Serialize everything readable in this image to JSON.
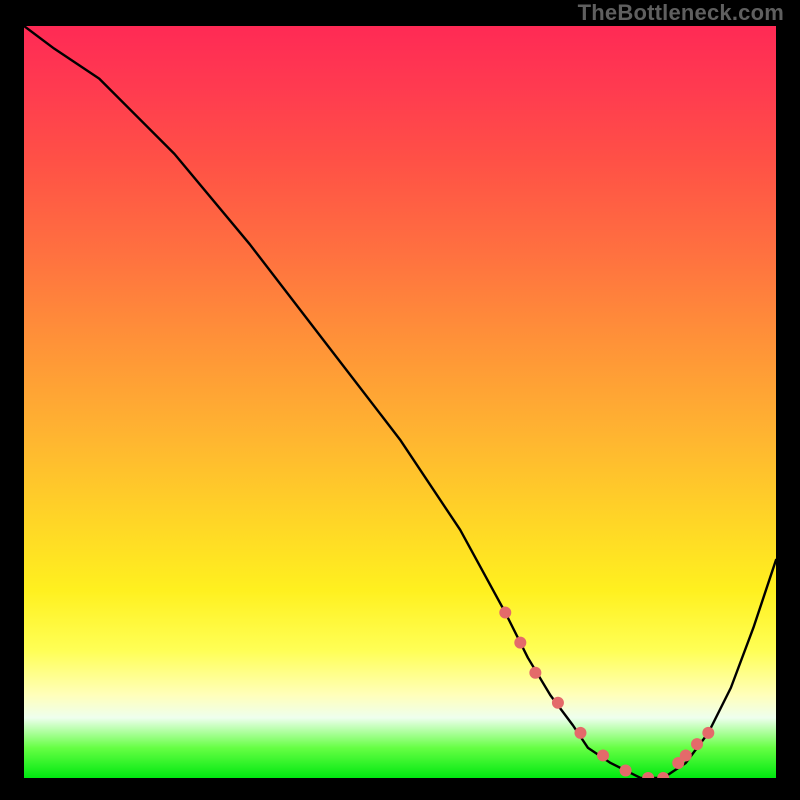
{
  "watermark": "TheBottleneck.com",
  "chart_data": {
    "type": "line",
    "title": "",
    "xlabel": "",
    "ylabel": "",
    "xlim": [
      0,
      100
    ],
    "ylim": [
      0,
      100
    ],
    "grid": false,
    "legend": false,
    "x": [
      0,
      4,
      10,
      20,
      30,
      40,
      50,
      58,
      64,
      67,
      70,
      73,
      75,
      78,
      82,
      85,
      88,
      91,
      94,
      97,
      100
    ],
    "series": [
      {
        "name": "bottleneck-curve",
        "color": "#000000",
        "values": [
          100,
          97,
          93,
          83,
          71,
          58,
          45,
          33,
          22,
          16,
          11,
          7,
          4,
          2,
          0,
          0,
          2,
          6,
          12,
          20,
          29
        ]
      }
    ],
    "markers": {
      "color": "#e46a6a",
      "radius_px": 6,
      "points_x": [
        64,
        66,
        68,
        71,
        74,
        77,
        80,
        83,
        85,
        87,
        88,
        89.5,
        91
      ],
      "points_y": [
        22,
        18,
        14,
        10,
        6,
        3,
        1,
        0,
        0,
        2,
        3,
        4.5,
        6
      ]
    },
    "gradient_stops": [
      {
        "pos": 0.0,
        "color": "#ff2a55"
      },
      {
        "pos": 0.08,
        "color": "#ff3a50"
      },
      {
        "pos": 0.18,
        "color": "#ff5146"
      },
      {
        "pos": 0.3,
        "color": "#ff7040"
      },
      {
        "pos": 0.42,
        "color": "#ff9238"
      },
      {
        "pos": 0.54,
        "color": "#ffb331"
      },
      {
        "pos": 0.65,
        "color": "#ffd327"
      },
      {
        "pos": 0.75,
        "color": "#fff01f"
      },
      {
        "pos": 0.83,
        "color": "#ffff55"
      },
      {
        "pos": 0.89,
        "color": "#ffffbb"
      },
      {
        "pos": 0.92,
        "color": "#eeffee"
      },
      {
        "pos": 0.96,
        "color": "#66ff44"
      },
      {
        "pos": 1.0,
        "color": "#00e810"
      }
    ]
  }
}
